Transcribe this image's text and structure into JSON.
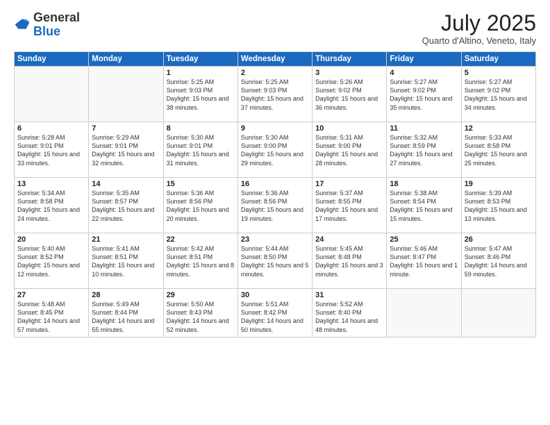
{
  "logo": {
    "general": "General",
    "blue": "Blue"
  },
  "header": {
    "month": "July 2025",
    "location": "Quarto d'Altino, Veneto, Italy"
  },
  "weekdays": [
    "Sunday",
    "Monday",
    "Tuesday",
    "Wednesday",
    "Thursday",
    "Friday",
    "Saturday"
  ],
  "weeks": [
    [
      {
        "day": "",
        "info": ""
      },
      {
        "day": "",
        "info": ""
      },
      {
        "day": "1",
        "info": "Sunrise: 5:25 AM\nSunset: 9:03 PM\nDaylight: 15 hours and 38 minutes."
      },
      {
        "day": "2",
        "info": "Sunrise: 5:25 AM\nSunset: 9:03 PM\nDaylight: 15 hours and 37 minutes."
      },
      {
        "day": "3",
        "info": "Sunrise: 5:26 AM\nSunset: 9:02 PM\nDaylight: 15 hours and 36 minutes."
      },
      {
        "day": "4",
        "info": "Sunrise: 5:27 AM\nSunset: 9:02 PM\nDaylight: 15 hours and 35 minutes."
      },
      {
        "day": "5",
        "info": "Sunrise: 5:27 AM\nSunset: 9:02 PM\nDaylight: 15 hours and 34 minutes."
      }
    ],
    [
      {
        "day": "6",
        "info": "Sunrise: 5:28 AM\nSunset: 9:01 PM\nDaylight: 15 hours and 33 minutes."
      },
      {
        "day": "7",
        "info": "Sunrise: 5:29 AM\nSunset: 9:01 PM\nDaylight: 15 hours and 32 minutes."
      },
      {
        "day": "8",
        "info": "Sunrise: 5:30 AM\nSunset: 9:01 PM\nDaylight: 15 hours and 31 minutes."
      },
      {
        "day": "9",
        "info": "Sunrise: 5:30 AM\nSunset: 9:00 PM\nDaylight: 15 hours and 29 minutes."
      },
      {
        "day": "10",
        "info": "Sunrise: 5:31 AM\nSunset: 9:00 PM\nDaylight: 15 hours and 28 minutes."
      },
      {
        "day": "11",
        "info": "Sunrise: 5:32 AM\nSunset: 8:59 PM\nDaylight: 15 hours and 27 minutes."
      },
      {
        "day": "12",
        "info": "Sunrise: 5:33 AM\nSunset: 8:58 PM\nDaylight: 15 hours and 25 minutes."
      }
    ],
    [
      {
        "day": "13",
        "info": "Sunrise: 5:34 AM\nSunset: 8:58 PM\nDaylight: 15 hours and 24 minutes."
      },
      {
        "day": "14",
        "info": "Sunrise: 5:35 AM\nSunset: 8:57 PM\nDaylight: 15 hours and 22 minutes."
      },
      {
        "day": "15",
        "info": "Sunrise: 5:36 AM\nSunset: 8:56 PM\nDaylight: 15 hours and 20 minutes."
      },
      {
        "day": "16",
        "info": "Sunrise: 5:36 AM\nSunset: 8:56 PM\nDaylight: 15 hours and 19 minutes."
      },
      {
        "day": "17",
        "info": "Sunrise: 5:37 AM\nSunset: 8:55 PM\nDaylight: 15 hours and 17 minutes."
      },
      {
        "day": "18",
        "info": "Sunrise: 5:38 AM\nSunset: 8:54 PM\nDaylight: 15 hours and 15 minutes."
      },
      {
        "day": "19",
        "info": "Sunrise: 5:39 AM\nSunset: 8:53 PM\nDaylight: 15 hours and 13 minutes."
      }
    ],
    [
      {
        "day": "20",
        "info": "Sunrise: 5:40 AM\nSunset: 8:52 PM\nDaylight: 15 hours and 12 minutes."
      },
      {
        "day": "21",
        "info": "Sunrise: 5:41 AM\nSunset: 8:51 PM\nDaylight: 15 hours and 10 minutes."
      },
      {
        "day": "22",
        "info": "Sunrise: 5:42 AM\nSunset: 8:51 PM\nDaylight: 15 hours and 8 minutes."
      },
      {
        "day": "23",
        "info": "Sunrise: 5:44 AM\nSunset: 8:50 PM\nDaylight: 15 hours and 5 minutes."
      },
      {
        "day": "24",
        "info": "Sunrise: 5:45 AM\nSunset: 8:48 PM\nDaylight: 15 hours and 3 minutes."
      },
      {
        "day": "25",
        "info": "Sunrise: 5:46 AM\nSunset: 8:47 PM\nDaylight: 15 hours and 1 minute."
      },
      {
        "day": "26",
        "info": "Sunrise: 5:47 AM\nSunset: 8:46 PM\nDaylight: 14 hours and 59 minutes."
      }
    ],
    [
      {
        "day": "27",
        "info": "Sunrise: 5:48 AM\nSunset: 8:45 PM\nDaylight: 14 hours and 57 minutes."
      },
      {
        "day": "28",
        "info": "Sunrise: 5:49 AM\nSunset: 8:44 PM\nDaylight: 14 hours and 55 minutes."
      },
      {
        "day": "29",
        "info": "Sunrise: 5:50 AM\nSunset: 8:43 PM\nDaylight: 14 hours and 52 minutes."
      },
      {
        "day": "30",
        "info": "Sunrise: 5:51 AM\nSunset: 8:42 PM\nDaylight: 14 hours and 50 minutes."
      },
      {
        "day": "31",
        "info": "Sunrise: 5:52 AM\nSunset: 8:40 PM\nDaylight: 14 hours and 48 minutes."
      },
      {
        "day": "",
        "info": ""
      },
      {
        "day": "",
        "info": ""
      }
    ]
  ]
}
